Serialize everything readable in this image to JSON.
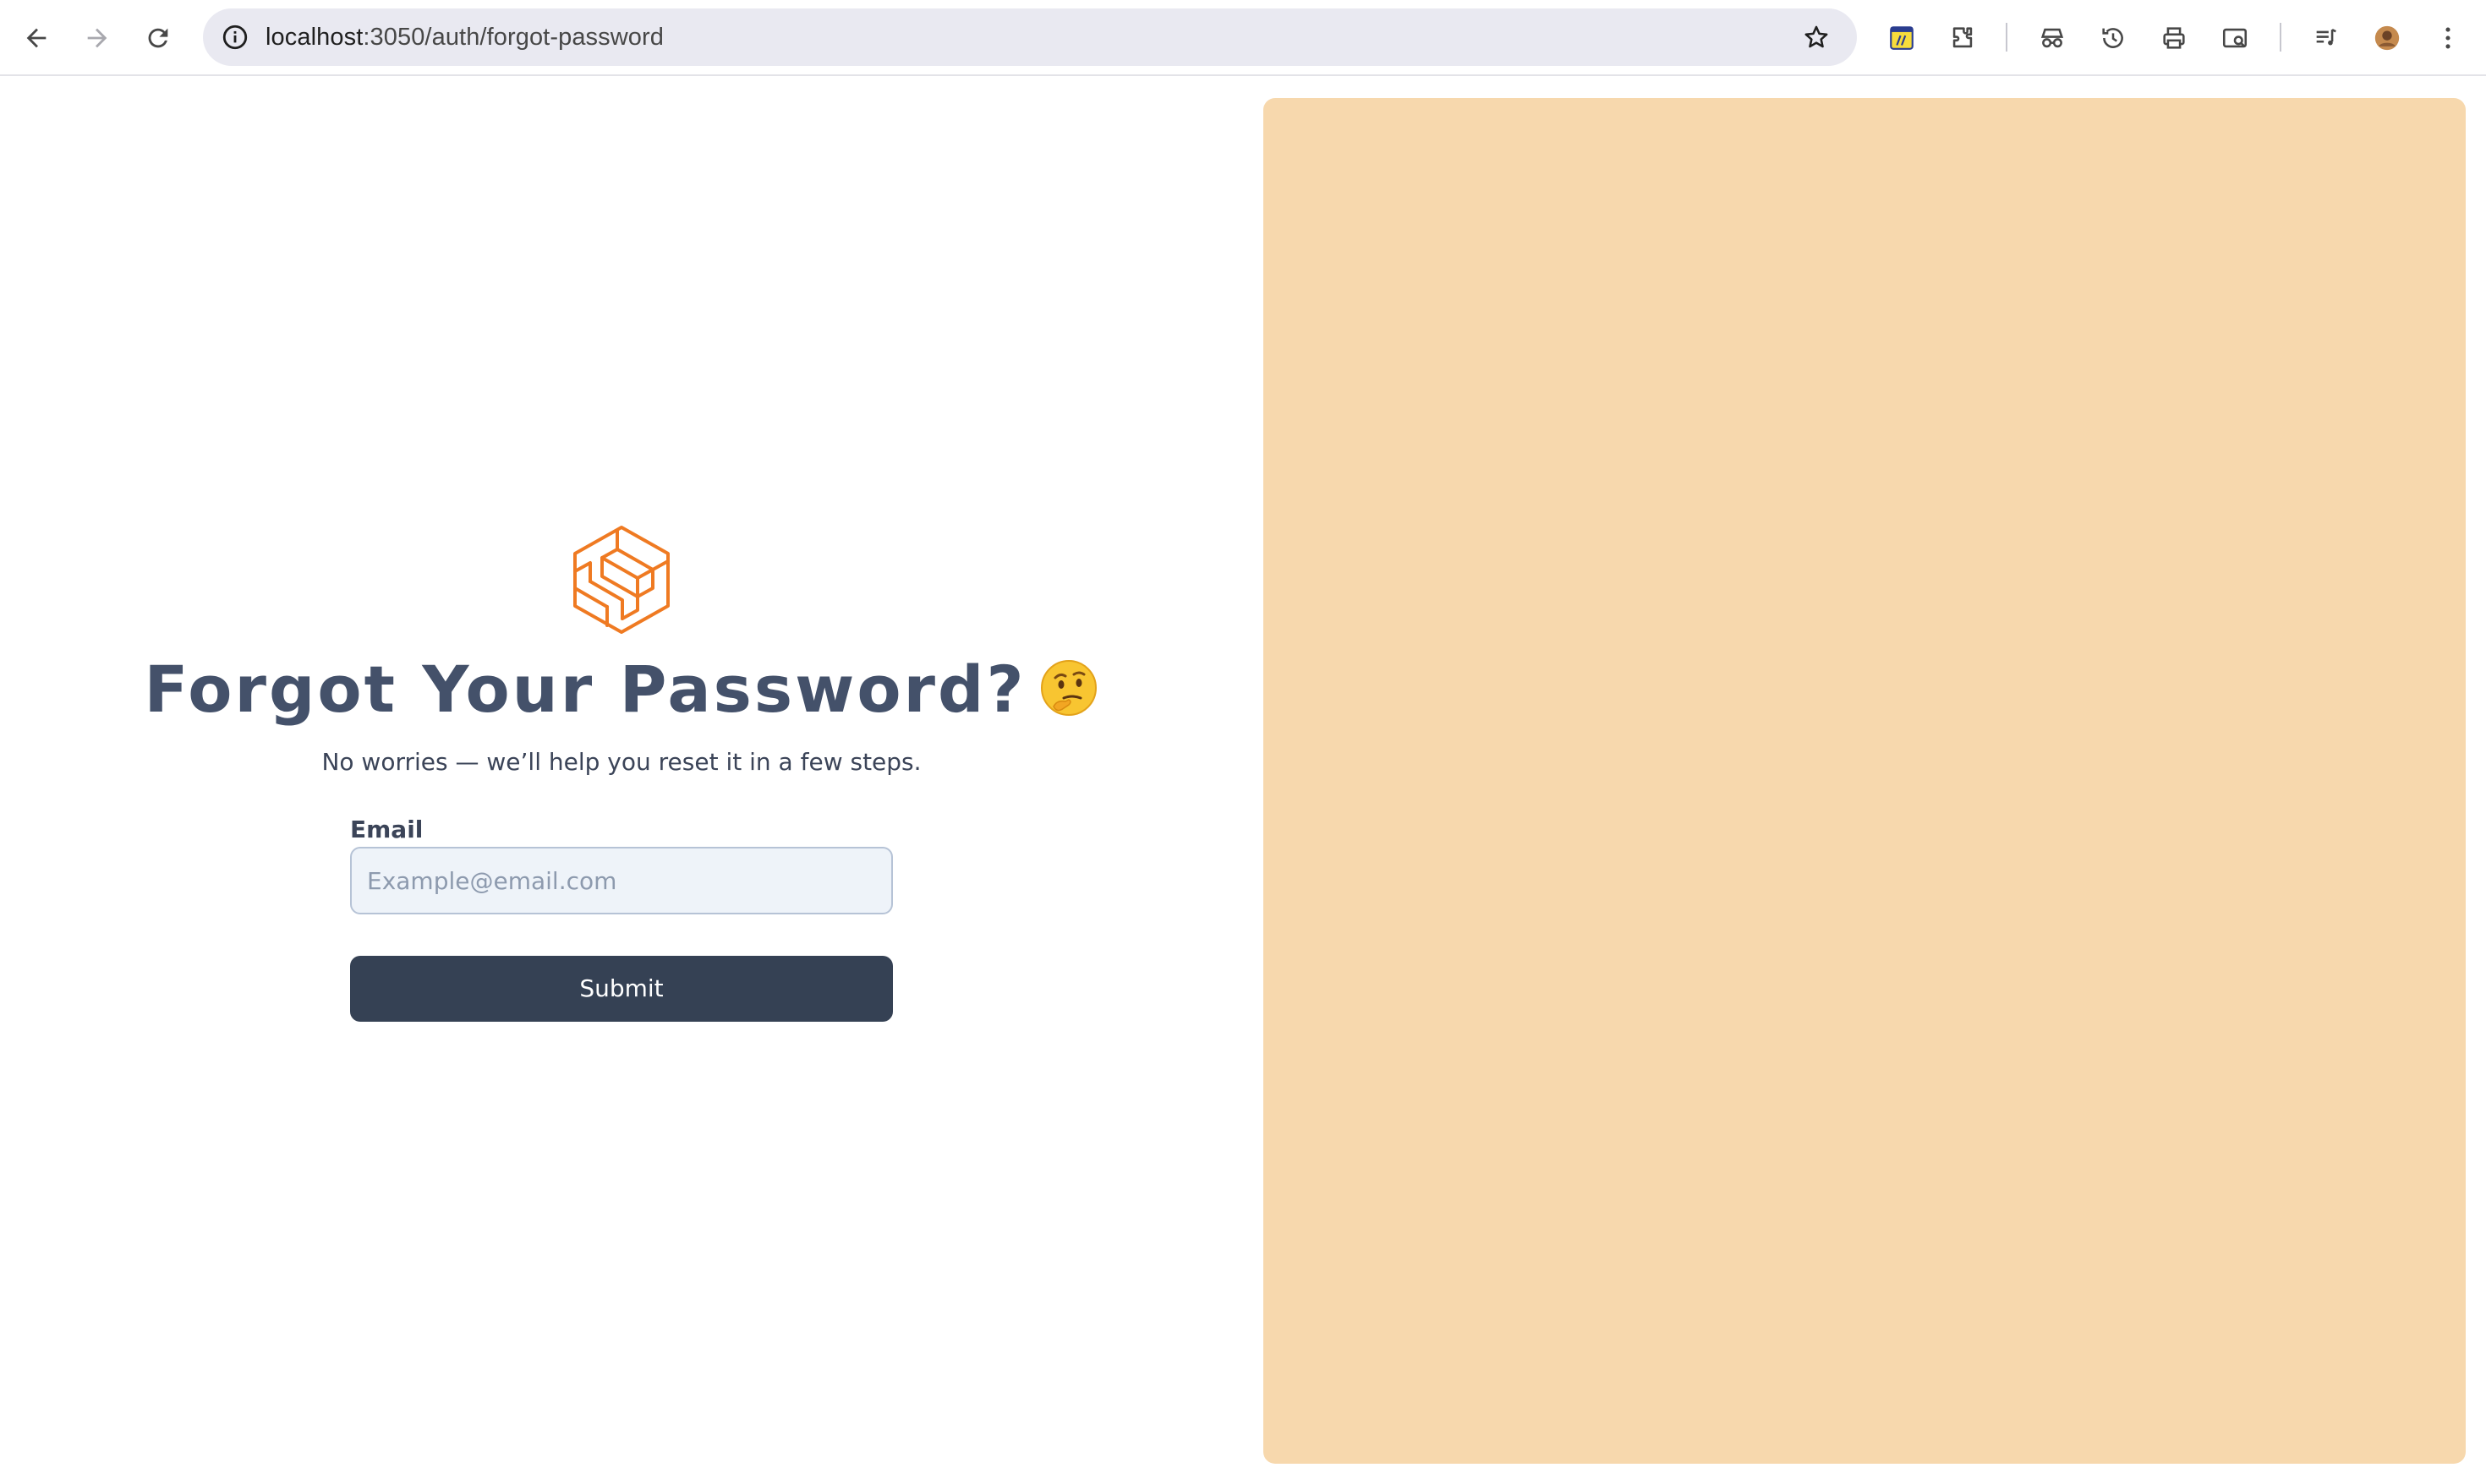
{
  "browser": {
    "url_host": "localhost",
    "url_path": ":3050/auth/forgot-password",
    "icons": {
      "back": "back-arrow-icon",
      "forward": "forward-arrow-icon",
      "reload": "reload-icon",
      "site_info": "info-icon",
      "bookmark": "star-icon",
      "extension_1": "notes-extension-icon",
      "extensions": "puzzle-icon",
      "incognito": "spy-icon",
      "history": "history-icon",
      "print": "printer-icon",
      "search_tab": "tab-search-icon",
      "media": "media-queue-icon",
      "profile": "avatar",
      "menu": "kebab-menu-icon"
    }
  },
  "form": {
    "logo": "orange-cube-logo",
    "title": "Forgot Your Password?",
    "title_emoji": "thinking-face-emoji",
    "subtitle": "No worries — we’ll help you reset it in a few steps.",
    "email_label": "Email",
    "email_value": "",
    "email_placeholder": "Example@email.com",
    "submit_label": "Submit"
  },
  "colors": {
    "title": "#44516a",
    "text": "#3b4458",
    "button_bg": "#354154",
    "input_bg": "#eef3f9",
    "input_border": "#b6c3d6",
    "logo": "#ef7a22",
    "right_panel": "#f7d8ad",
    "omnibox_bg": "#e9e9f1"
  }
}
